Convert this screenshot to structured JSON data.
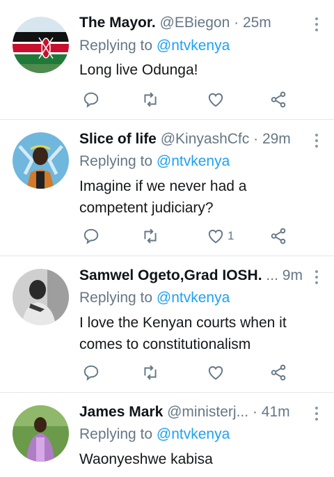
{
  "tweets": [
    {
      "name": "The Mayor.",
      "handle": "@EBiegon",
      "time": "25m",
      "replying_prefix": "Replying to",
      "replying_to": "@ntvkenya",
      "text": "Long live Odunga!",
      "likes": ""
    },
    {
      "name": "Slice of life",
      "handle": "@KinyashCfc",
      "time": "29m",
      "replying_prefix": "Replying to",
      "replying_to": "@ntvkenya",
      "text": "Imagine if we never had a competent judiciary?",
      "likes": "1"
    },
    {
      "name": "Samwel Ogeto,Grad IOSH.",
      "handle": "...",
      "time": "9m",
      "replying_prefix": "Replying to",
      "replying_to": "@ntvkenya",
      "text": "I love the Kenyan courts when it comes to constitutionalism",
      "likes": ""
    },
    {
      "name": "James Mark",
      "handle": "@ministerj...",
      "time": "41m",
      "replying_prefix": "Replying to",
      "replying_to": "@ntvkenya",
      "text": "Waonyeshwe kabisa",
      "likes": ""
    }
  ],
  "icons": [
    "reply-icon",
    "retweet-icon",
    "like-icon",
    "share-icon",
    "more-icon"
  ],
  "colors": {
    "mention": "#1da1f2",
    "muted": "#657786",
    "divider": "#e1e8ed"
  }
}
